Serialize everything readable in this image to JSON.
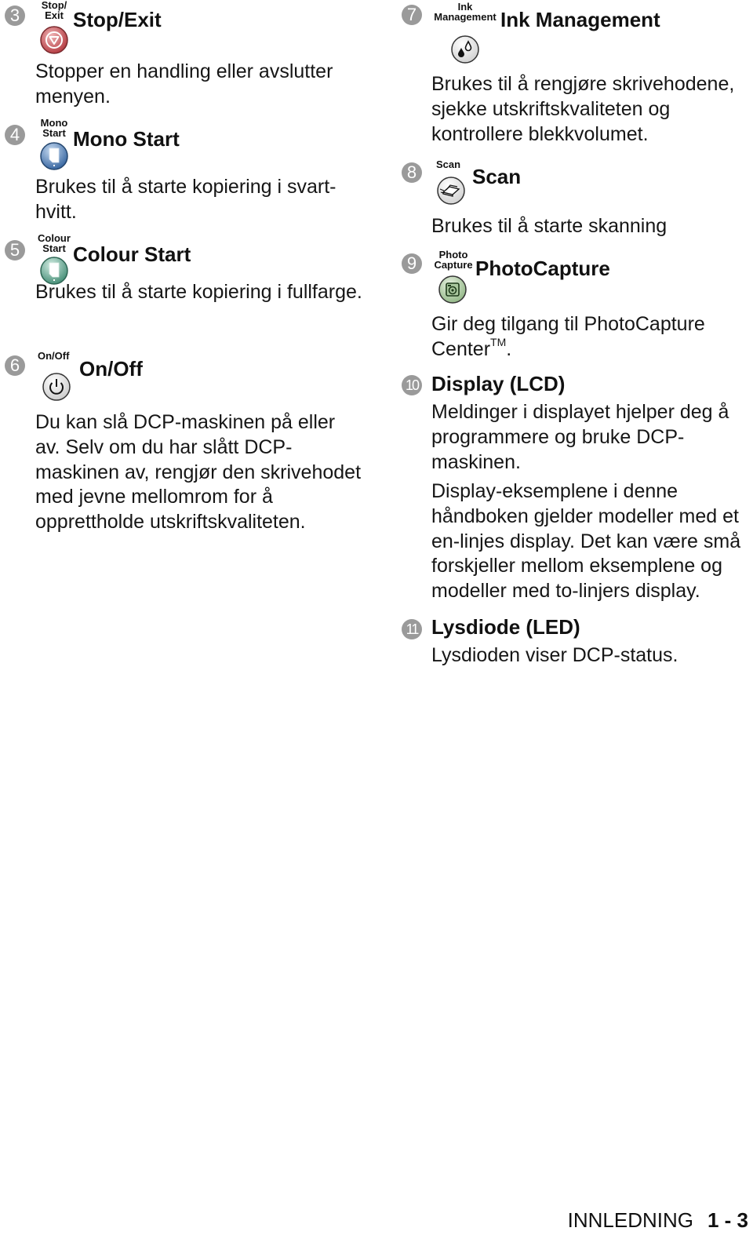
{
  "left_column": [
    {
      "number": "3",
      "button_label_lines": [
        "Stop/",
        "Exit"
      ],
      "title": "Stop/Exit",
      "icon": "stop-exit-icon",
      "description": "Stopper en handling eller avslutter menyen."
    },
    {
      "number": "4",
      "button_label_lines": [
        "Mono",
        "Start"
      ],
      "title": "Mono Start",
      "icon": "mono-start-icon",
      "description": "Brukes til å starte kopiering i svart-hvitt."
    },
    {
      "number": "5",
      "button_label_lines": [
        "Colour",
        "Start"
      ],
      "title": "Colour Start",
      "icon": "colour-start-icon",
      "description": "Brukes til å starte kopiering i fullfarge."
    },
    {
      "number": "6",
      "button_label_lines": [
        "On/Off"
      ],
      "title": "On/Off",
      "icon": "power-icon",
      "description": "Du kan slå DCP-maskinen på eller av. Selv om du har slått DCP-maskinen av, rengjør den skrivehodet med jevne mellomrom for å opprettholde utskriftskvaliteten."
    }
  ],
  "right_column": [
    {
      "number": "7",
      "button_label_lines": [
        "Ink",
        "Management"
      ],
      "title": "Ink Management",
      "icon": "ink-drops-icon",
      "description": "Brukes til å rengjøre skrivehodene, sjekke utskriftskvaliteten og kontrollere blekkvolumet."
    },
    {
      "number": "8",
      "button_label_lines": [
        "Scan"
      ],
      "title": "Scan",
      "icon": "scanner-icon",
      "description": "Brukes til å starte skanning"
    },
    {
      "number": "9",
      "button_label_lines": [
        "Photo",
        "Capture"
      ],
      "title": "PhotoCapture",
      "icon": "camera-icon",
      "description": "Gir deg tilgang til PhotoCapture Center",
      "description_suffix": "TM",
      "description_end": "."
    },
    {
      "number": "10",
      "title": "Display (LCD)",
      "paragraphs": [
        "Meldinger i displayet hjelper deg å programmere og bruke DCP-maskinen.",
        "Display-eksemplene i denne håndboken gjelder modeller med et en-linjes display. Det kan være små forskjeller mellom eksemplene og modeller med to-linjers display."
      ]
    },
    {
      "number": "11",
      "title": "Lysdiode (LED)",
      "paragraphs": [
        "Lysdioden viser DCP-status."
      ]
    }
  ],
  "footer": {
    "section": "INNLEDNING",
    "page": "1 - 3"
  },
  "colors": {
    "number_badge": "#9a9a9a",
    "stop_button": "#c9545a",
    "mono_button": "#4f7fb8",
    "colour_button": "#5ea28e",
    "photo_button": "#6f9a64"
  }
}
